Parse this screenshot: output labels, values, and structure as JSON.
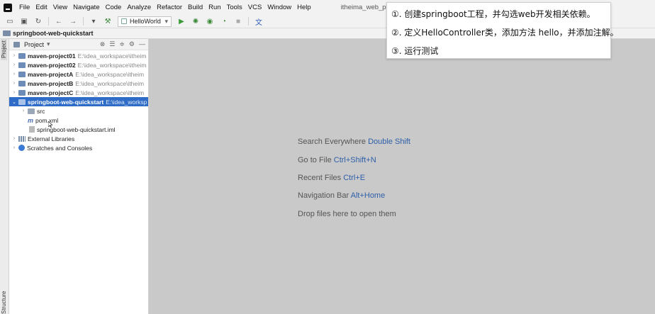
{
  "menubar": {
    "items": [
      "File",
      "Edit",
      "View",
      "Navigate",
      "Code",
      "Analyze",
      "Refactor",
      "Build",
      "Run",
      "Tools",
      "VCS",
      "Window",
      "Help"
    ],
    "window_title": "itheima_web_project"
  },
  "toolbar": {
    "run_config": "HelloWorld"
  },
  "breadcrumb": {
    "project": "springboot-web-quickstart"
  },
  "stripe": {
    "project_label": "Project",
    "structure_label": "Structure"
  },
  "project_panel": {
    "title": "Project",
    "tree": [
      {
        "name": "maven-project01",
        "path": "E:\\idea_workspace\\itheim",
        "bold": true
      },
      {
        "name": "maven-project02",
        "path": "E:\\idea_workspace\\itheim",
        "bold": true
      },
      {
        "name": "maven-projectA",
        "path": "E:\\idea_workspace\\itheim",
        "bold": true
      },
      {
        "name": "maven-projectB",
        "path": "E:\\idea_workspace\\itheim",
        "bold": true
      },
      {
        "name": "maven-projectC",
        "path": "E:\\idea_workspace\\itheim",
        "bold": true
      },
      {
        "name": "springboot-web-quickstart",
        "path": "E:\\idea_worksp",
        "bold": true,
        "selected": true
      },
      {
        "name": "src"
      },
      {
        "name": "pom.xml"
      },
      {
        "name": "springboot-web-quickstart.iml"
      },
      {
        "name": "External Libraries"
      },
      {
        "name": "Scratches and Consoles"
      }
    ]
  },
  "editor_hints": [
    {
      "text": "Search Everywhere",
      "shortcut": "Double Shift"
    },
    {
      "text": "Go to File",
      "shortcut": "Ctrl+Shift+N"
    },
    {
      "text": "Recent Files",
      "shortcut": "Ctrl+E"
    },
    {
      "text": "Navigation Bar",
      "shortcut": "Alt+Home"
    },
    {
      "text": "Drop files here to open them",
      "shortcut": ""
    }
  ],
  "annotation": {
    "lines": [
      "①. 创建springboot工程，并勾选web开发相关依赖。",
      "②. 定义HelloController类，添加方法 hello，并添加注解。",
      "③. 运行测试"
    ]
  },
  "colors": {
    "selection": "#2e6cc8",
    "shortcut": "#2d5ea9",
    "editor_bg": "#c9c9c9"
  }
}
